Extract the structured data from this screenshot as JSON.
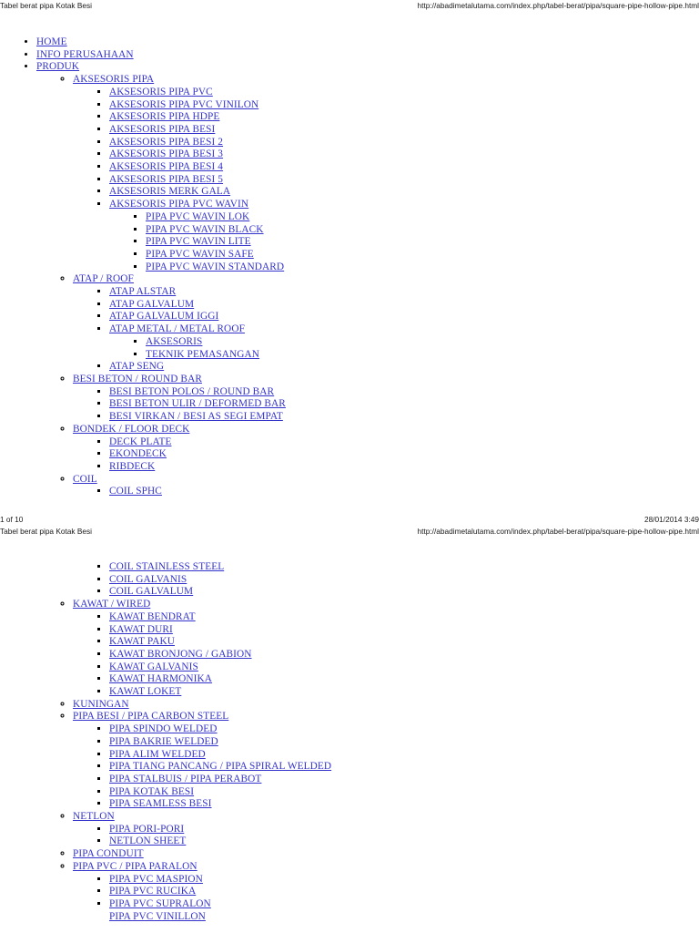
{
  "document": {
    "title": "Tabel berat pipa Kotak Besi",
    "url": "http://abadimetalutama.com/index.php/tabel-berat/pipa/square-pipe-hollow-pipe.html",
    "page_indicator": "1 of 10",
    "timestamp": "28/01/2014 3:49",
    "link_color": "#3333cc",
    "text_color": "#1a1a1a"
  },
  "page1": {
    "header": {
      "left": "Tabel berat pipa Kotak Besi",
      "right": "http://abadimetalutama.com/index.php/tabel-berat/pipa/square-pipe-hollow-pipe.html"
    },
    "footer": {
      "left": "1 of 10",
      "right": "28/01/2014 3:49"
    },
    "nav": [
      {
        "label": "HOME"
      },
      {
        "label": "INFO PERUSAHAAN"
      },
      {
        "label": "PRODUK",
        "children": [
          {
            "label": "AKSESORIS PIPA",
            "children": [
              {
                "label": "AKSESORIS PIPA PVC"
              },
              {
                "label": "AKSESORIS PIPA PVC VINILON"
              },
              {
                "label": "AKSESORIS PIPA HDPE"
              },
              {
                "label": "AKSESORIS PIPA BESI"
              },
              {
                "label": "AKSESORIS PIPA BESI 2"
              },
              {
                "label": "AKSESORIS PIPA BESI 3"
              },
              {
                "label": "AKSESORIS PIPA BESI 4"
              },
              {
                "label": "AKSESORIS PIPA BESI 5"
              },
              {
                "label": "AKSESORIS MERK GALA"
              },
              {
                "label": "AKSESORIS PIPA PVC WAVIN",
                "children": [
                  {
                    "label": "PIPA PVC WAVIN LOK"
                  },
                  {
                    "label": "PIPA PVC WAVIN BLACK"
                  },
                  {
                    "label": "PIPA PVC WAVIN LITE"
                  },
                  {
                    "label": "PIPA PVC WAVIN SAFE"
                  },
                  {
                    "label": "PIPA PVC WAVIN STANDARD"
                  }
                ]
              }
            ]
          },
          {
            "label": "ATAP / ROOF",
            "children": [
              {
                "label": "ATAP ALSTAR"
              },
              {
                "label": "ATAP GALVALUM"
              },
              {
                "label": "ATAP GALVALUM IGGI"
              },
              {
                "label": "ATAP METAL / METAL ROOF",
                "children": [
                  {
                    "label": "AKSESORIS"
                  },
                  {
                    "label": "TEKNIK PEMASANGAN"
                  }
                ]
              },
              {
                "label": "ATAP SENG"
              }
            ]
          },
          {
            "label": "BESI BETON / ROUND BAR",
            "children": [
              {
                "label": "BESI BETON POLOS / ROUND BAR"
              },
              {
                "label": "BESI BETON ULIR / DEFORMED BAR"
              },
              {
                "label": "BESI VIRKAN / BESI AS SEGI EMPAT"
              }
            ]
          },
          {
            "label": "BONDEK / FLOOR DECK",
            "children": [
              {
                "label": "DECK PLATE"
              },
              {
                "label": "EKONDECK"
              },
              {
                "label": "RIBDECK"
              }
            ]
          },
          {
            "label": "COIL",
            "children": [
              {
                "label": "COIL SPHC"
              }
            ]
          }
        ]
      }
    ]
  },
  "page2": {
    "header": {
      "left": "Tabel berat pipa Kotak Besi",
      "right": "http://abadimetalutama.com/index.php/tabel-berat/pipa/square-pipe-hollow-pipe.html"
    },
    "coil_continued": [
      {
        "label": "COIL STAINLESS STEEL"
      },
      {
        "label": "COIL GALVANIS"
      },
      {
        "label": "COIL GALVALUM"
      }
    ],
    "nav": [
      {
        "label": "KAWAT / WIRED",
        "children": [
          {
            "label": "KAWAT BENDRAT"
          },
          {
            "label": "KAWAT DURI"
          },
          {
            "label": "KAWAT PAKU"
          },
          {
            "label": "KAWAT BRONJONG / GABION"
          },
          {
            "label": "KAWAT GALVANIS"
          },
          {
            "label": "KAWAT HARMONIKA"
          },
          {
            "label": "KAWAT LOKET"
          }
        ]
      },
      {
        "label": "KUNINGAN"
      },
      {
        "label": "PIPA BESI / PIPA CARBON STEEL",
        "children": [
          {
            "label": "PIPA SPINDO WELDED"
          },
          {
            "label": "PIPA BAKRIE WELDED"
          },
          {
            "label": "PIPA ALIM WELDED"
          },
          {
            "label": "PIPA TIANG PANCANG / PIPA SPIRAL WELDED"
          },
          {
            "label": "PIPA STALBUIS / PIPA PERABOT"
          },
          {
            "label": "PIPA KOTAK BESI"
          },
          {
            "label": "PIPA SEAMLESS BESI"
          }
        ]
      },
      {
        "label": "NETLON",
        "children": [
          {
            "label": "PIPA PORI-PORI"
          },
          {
            "label": "NETLON SHEET"
          }
        ]
      },
      {
        "label": "PIPA CONDUIT"
      },
      {
        "label": "PIPA PVC / PIPA PARALON",
        "children": [
          {
            "label": "PIPA PVC MASPION"
          },
          {
            "label": "PIPA PVC RUCIKA"
          },
          {
            "label": "PIPA PVC SUPRALON"
          },
          {
            "label": "PIPA PVC VINILLON"
          }
        ]
      }
    ]
  }
}
